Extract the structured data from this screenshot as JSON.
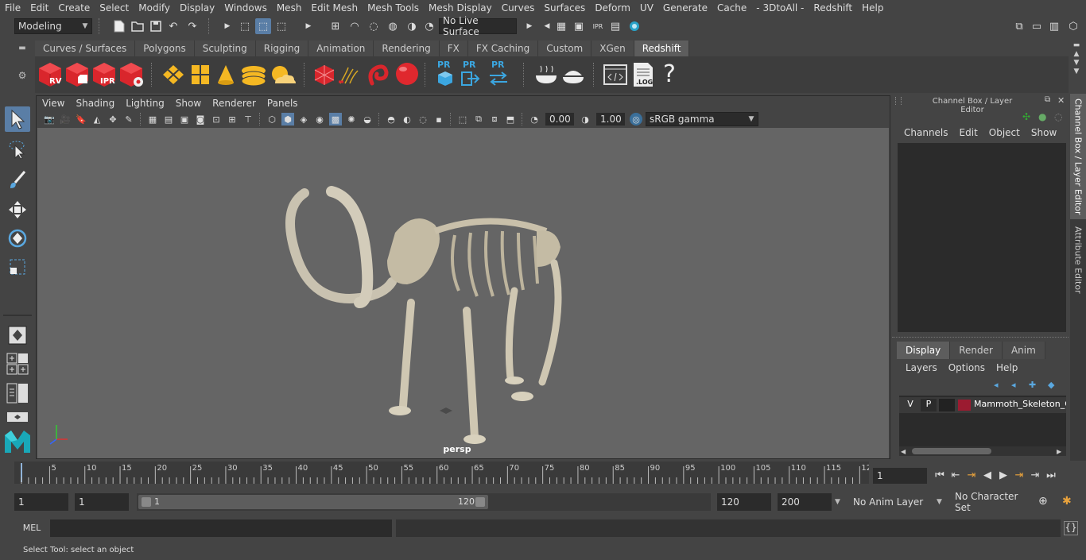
{
  "menubar": [
    "File",
    "Edit",
    "Create",
    "Select",
    "Modify",
    "Display",
    "Windows",
    "Mesh",
    "Edit Mesh",
    "Mesh Tools",
    "Mesh Display",
    "Curves",
    "Surfaces",
    "Deform",
    "UV",
    "Generate",
    "Cache",
    "- 3DtoAll -",
    "Redshift",
    "Help"
  ],
  "status": {
    "mode": "Modeling",
    "live_surface": "No Live Surface"
  },
  "shelf": {
    "tabs": [
      "Curves / Surfaces",
      "Polygons",
      "Sculpting",
      "Rigging",
      "Animation",
      "Rendering",
      "FX",
      "FX Caching",
      "Custom",
      "XGen",
      "Redshift"
    ],
    "active_tab": "Redshift",
    "icon_labels": {
      "rv": "RV",
      "ipr": "IPR",
      "pr": "PR",
      "log": ".LOG",
      "help": "?"
    }
  },
  "viewport": {
    "menu": [
      "View",
      "Shading",
      "Lighting",
      "Show",
      "Renderer",
      "Panels"
    ],
    "exposure": "0.00",
    "gamma": "1.00",
    "colorspace": "sRGB gamma",
    "camera_label": "persp"
  },
  "channelbox": {
    "title": "Channel Box / Layer Editor",
    "menu": [
      "Channels",
      "Edit",
      "Object",
      "Show"
    ],
    "layer_tabs": [
      "Display",
      "Render",
      "Anim"
    ],
    "active_layer_tab": "Display",
    "layer_menu": [
      "Layers",
      "Options",
      "Help"
    ],
    "layer": {
      "v": "V",
      "p": "P",
      "name": "Mammoth_Skeleton_C",
      "color": "#9b1b30"
    }
  },
  "sidetabs": {
    "channel": "Channel Box / Layer Editor",
    "attribute": "Attribute Editor"
  },
  "timeline": {
    "ticks": [
      "5",
      "10",
      "15",
      "20",
      "25",
      "30",
      "35",
      "40",
      "45",
      "50",
      "55",
      "60",
      "65",
      "70",
      "75",
      "80",
      "85",
      "90",
      "95",
      "100",
      "105",
      "110",
      "115",
      "12"
    ],
    "start_label": "1",
    "current_frame": "1"
  },
  "range": {
    "start": "1",
    "playback_start": "1",
    "slider_start": "1",
    "slider_end": "120",
    "playback_end": "120",
    "end": "200",
    "anim_layer": "No Anim Layer",
    "character_set": "No Character Set"
  },
  "cmdline": {
    "label": "MEL"
  },
  "helpline": {
    "text": "Select Tool: select an object"
  }
}
